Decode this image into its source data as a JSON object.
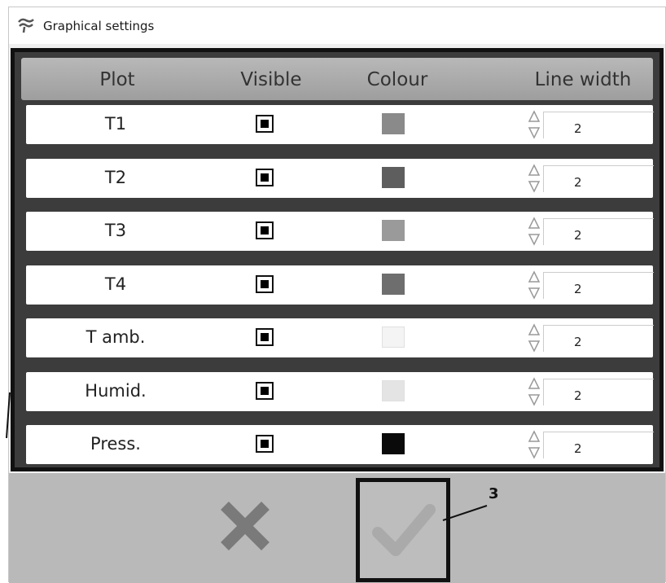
{
  "window": {
    "title": "Graphical settings"
  },
  "table": {
    "headers": {
      "plot": "Plot",
      "visible": "Visible",
      "colour": "Colour",
      "line_width": "Line width"
    },
    "rows": [
      {
        "name": "T1",
        "visible": true,
        "colour": "#8a8a8a",
        "line_width": "2"
      },
      {
        "name": "T2",
        "visible": true,
        "colour": "#5e5e5e",
        "line_width": "2"
      },
      {
        "name": "T3",
        "visible": true,
        "colour": "#9a9a9a",
        "line_width": "2"
      },
      {
        "name": "T4",
        "visible": true,
        "colour": "#6e6e6e",
        "line_width": "2"
      },
      {
        "name": "T amb.",
        "visible": true,
        "colour": "#f4f4f4",
        "line_width": "2"
      },
      {
        "name": "Humid.",
        "visible": true,
        "colour": "#e4e4e4",
        "line_width": "2"
      },
      {
        "name": "Press.",
        "visible": true,
        "colour": "#0a0a0a",
        "line_width": "2"
      }
    ]
  },
  "footer": {
    "cancel_icon": "cross-icon",
    "confirm_icon": "checkmark-icon"
  },
  "callouts": {
    "confirm_label": "3"
  },
  "colors": {
    "frame": "#111111",
    "header_bg": "#a8a8a8",
    "footer_bg": "#b9b9b9",
    "cancel": "#7a7a7a"
  }
}
